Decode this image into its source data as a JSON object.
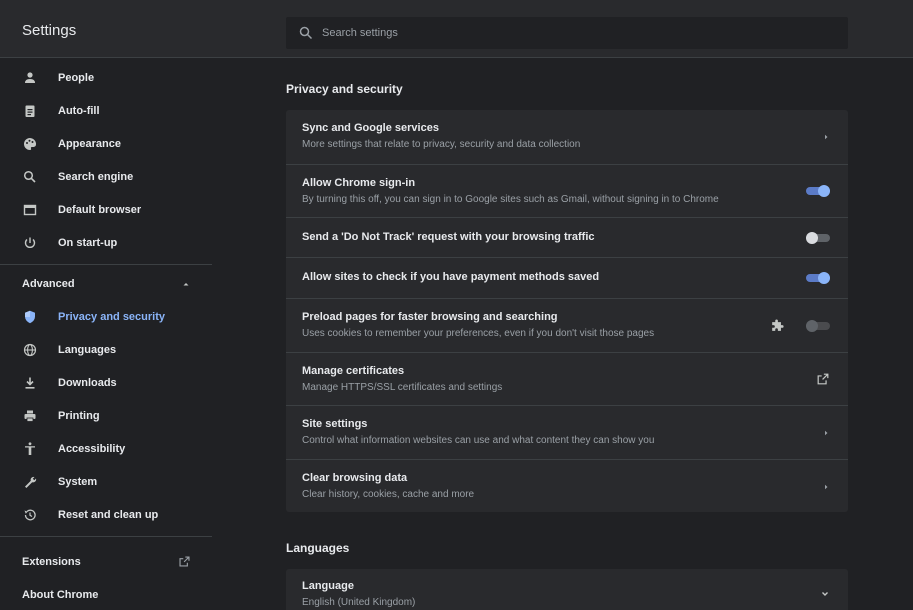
{
  "header": {
    "title": "Settings",
    "search_placeholder": "Search settings"
  },
  "sidebar": {
    "items": [
      {
        "label": "People",
        "icon": "person-icon"
      },
      {
        "label": "Auto-fill",
        "icon": "clipboard-icon"
      },
      {
        "label": "Appearance",
        "icon": "palette-icon"
      },
      {
        "label": "Search engine",
        "icon": "search-icon"
      },
      {
        "label": "Default browser",
        "icon": "browser-icon"
      },
      {
        "label": "On start-up",
        "icon": "power-icon"
      }
    ],
    "advanced_label": "Advanced",
    "advanced_items": [
      {
        "label": "Privacy and security",
        "icon": "shield-icon",
        "active": true
      },
      {
        "label": "Languages",
        "icon": "globe-icon"
      },
      {
        "label": "Downloads",
        "icon": "download-icon"
      },
      {
        "label": "Printing",
        "icon": "printer-icon"
      },
      {
        "label": "Accessibility",
        "icon": "accessibility-icon"
      },
      {
        "label": "System",
        "icon": "wrench-icon"
      },
      {
        "label": "Reset and clean up",
        "icon": "history-icon"
      }
    ],
    "extensions_label": "Extensions",
    "about_label": "About Chrome"
  },
  "privacy": {
    "title": "Privacy and security",
    "rows": [
      {
        "title": "Sync and Google services",
        "subtitle": "More settings that relate to privacy, security and data collection",
        "control": "chevron"
      },
      {
        "title": "Allow Chrome sign-in",
        "subtitle": "By turning this off, you can sign in to Google sites such as Gmail, without signing in to Chrome",
        "control": "toggle-on"
      },
      {
        "title": "Send a 'Do Not Track' request with your browsing traffic",
        "control": "toggle-off"
      },
      {
        "title": "Allow sites to check if you have payment methods saved",
        "control": "toggle-on"
      },
      {
        "title": "Preload pages for faster browsing and searching",
        "subtitle": "Uses cookies to remember your preferences, even if you don't visit those pages",
        "control": "toggle-disabled"
      },
      {
        "title": "Manage certificates",
        "subtitle": "Manage HTTPS/SSL certificates and settings",
        "control": "external-link"
      },
      {
        "title": "Site settings",
        "subtitle": "Control what information websites can use and what content they can show you",
        "control": "chevron"
      },
      {
        "title": "Clear browsing data",
        "subtitle": "Clear history, cookies, cache and more",
        "control": "chevron"
      }
    ]
  },
  "languages": {
    "title": "Languages",
    "row": {
      "title": "Language",
      "subtitle": "English (United Kingdom)"
    }
  },
  "colors": {
    "accent": "#8ab4f8",
    "background": "#202124",
    "card": "#292a2d"
  }
}
